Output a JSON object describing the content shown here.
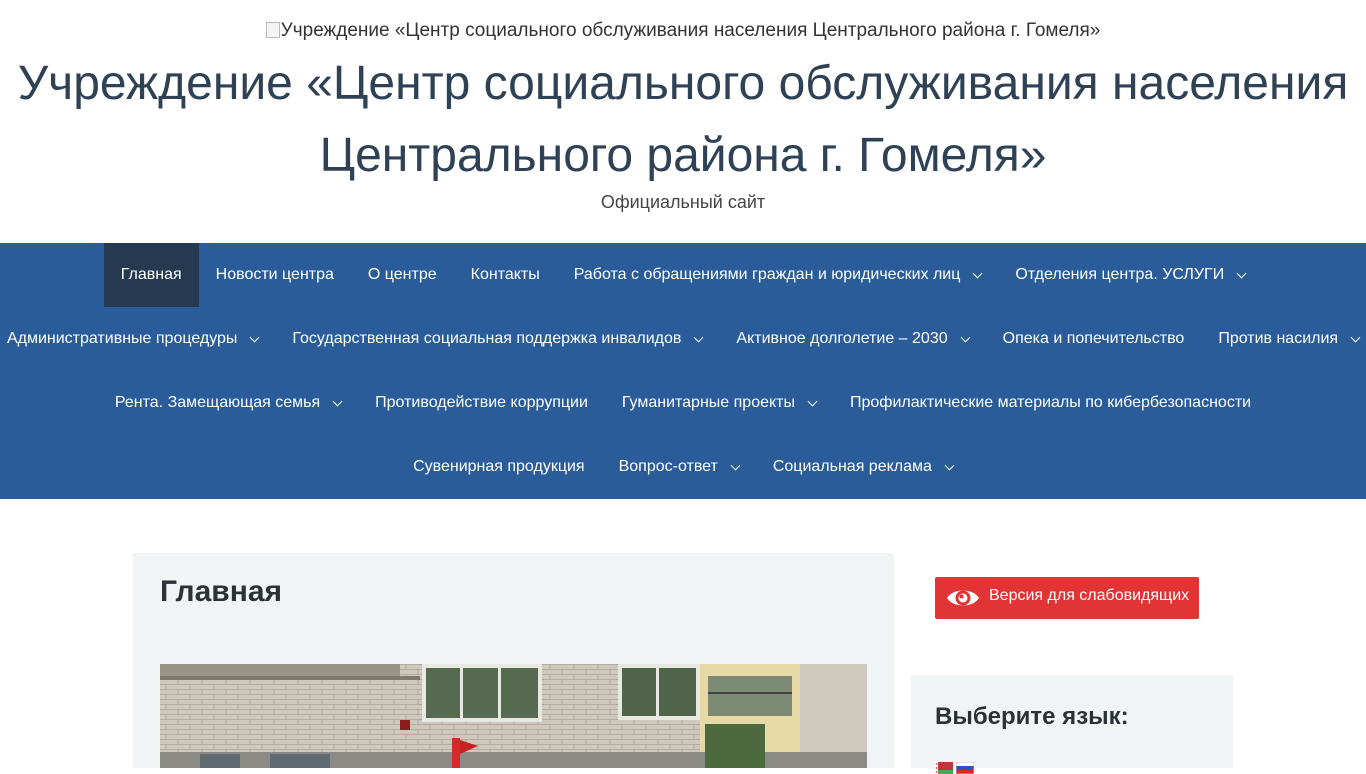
{
  "header": {
    "logo_alt": "Учреждение «Центр социального обслуживания населения Центрального района г. Гомеля»",
    "title_line1": "Учреждение «Центр социального обслуживания населения",
    "title_line2": "Центрального района г. Гомеля»",
    "tagline": "Официальный сайт"
  },
  "nav": {
    "rows": [
      [
        {
          "label": "Главная",
          "active": true,
          "dropdown": false
        },
        {
          "label": "Новости центра",
          "dropdown": false
        },
        {
          "label": "О центре",
          "dropdown": false
        },
        {
          "label": "Контакты",
          "dropdown": false
        },
        {
          "label": "Работа с обращениями граждан и юридических лиц",
          "dropdown": true
        },
        {
          "label": "Отделения центра. УСЛУГИ",
          "dropdown": true
        }
      ],
      [
        {
          "label": "Административные процедуры",
          "dropdown": true
        },
        {
          "label": "Государственная социальная поддержка инвалидов",
          "dropdown": true
        },
        {
          "label": "Активное долголетие – 2030",
          "dropdown": true
        },
        {
          "label": "Опека и попечительство",
          "dropdown": false
        },
        {
          "label": "Против насилия",
          "dropdown": true
        }
      ],
      [
        {
          "label": "Рента. Замещающая семья",
          "dropdown": true
        },
        {
          "label": "Противодействие коррупции",
          "dropdown": false
        },
        {
          "label": "Гуманитарные проекты",
          "dropdown": true
        },
        {
          "label": "Профилактические материалы по кибербезопасности",
          "dropdown": false
        }
      ],
      [
        {
          "label": "Сувенирная продукция",
          "dropdown": false
        },
        {
          "label": "Вопрос-ответ",
          "dropdown": true
        },
        {
          "label": "Социальная реклама",
          "dropdown": true
        }
      ]
    ]
  },
  "main": {
    "page_title": "Главная"
  },
  "sidebar": {
    "vision_button": "Версия для слабовидящих",
    "language_title": "Выберите язык:"
  },
  "colors": {
    "nav_bg": "#2a5c9a",
    "nav_active_bg": "#253a50",
    "title_color": "#2f4154",
    "vision_button_bg": "#e23434",
    "panel_bg": "#f1f4f5"
  },
  "icons": {
    "vision": "eye-icon",
    "dropdown": "chevron-down-icon",
    "flags": [
      "belarus-flag-icon",
      "russia-flag-icon"
    ]
  }
}
